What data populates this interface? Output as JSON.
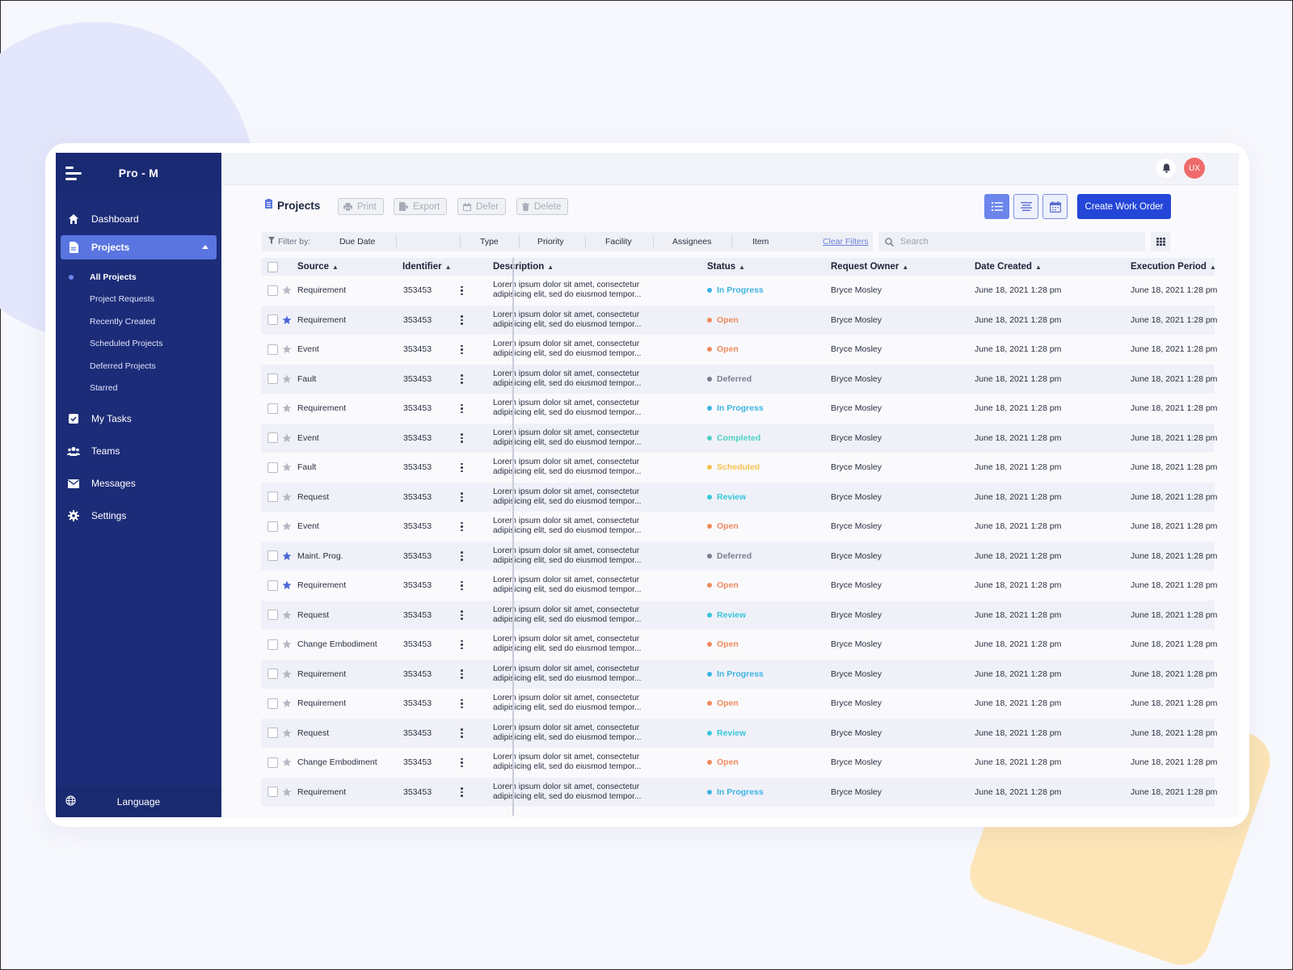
{
  "app": {
    "brand": "Pro - M"
  },
  "sidebar": {
    "items": [
      {
        "label": "Dashboard",
        "icon": "home-icon"
      },
      {
        "label": "Projects",
        "icon": "document-icon",
        "active": true
      },
      {
        "label": "My Tasks",
        "icon": "checkbox-icon"
      },
      {
        "label": "Teams",
        "icon": "team-icon"
      },
      {
        "label": "Messages",
        "icon": "mail-icon"
      },
      {
        "label": "Settings",
        "icon": "gear-icon"
      }
    ],
    "subitems": [
      {
        "label": "All Projects"
      },
      {
        "label": "Project Requests"
      },
      {
        "label": "Recently Created"
      },
      {
        "label": "Scheduled Projects"
      },
      {
        "label": "Deferred Projects"
      },
      {
        "label": "Starred"
      }
    ],
    "language": "Language"
  },
  "topbar": {
    "avatar": "UX"
  },
  "toolbar": {
    "title": "Projects",
    "print": "Print",
    "export": "Export",
    "defer": "Defer",
    "delete": "Delete",
    "create": "Create Work Order"
  },
  "filters": {
    "label": "Filter by:",
    "items": [
      "Due Date",
      "Type",
      "Priority",
      "Facility",
      "Assignees",
      "Item"
    ],
    "clear": "Clear Filters",
    "search_placeholder": "Search"
  },
  "table": {
    "columns": [
      "Source",
      "Identifier",
      "Description",
      "Status",
      "Request Owner",
      "Date Created",
      "Execution Period"
    ],
    "status_colors": {
      "In Progress": "#3fb3e3",
      "Open": "#f08a5d",
      "Deferred": "#7a7f8e",
      "Completed": "#4fd1c5",
      "Scheduled": "#f5c04f",
      "Review": "#38c6dc"
    },
    "rows": [
      {
        "source": "Requirement",
        "starred": false,
        "id": "353453",
        "desc1": "Lorem ipsum dolor sit amet, consectetur",
        "desc2": "adipisicing elit, sed do eiusmod tempor...",
        "status": "In Progress",
        "owner": "Bryce Mosley",
        "created": "June 18, 2021 1:28 pm",
        "exec": "June 18, 2021 1:28 pm"
      },
      {
        "source": "Requirement",
        "starred": true,
        "id": "353453",
        "desc1": "Lorem ipsum dolor sit amet, consectetur",
        "desc2": "adipisicing elit, sed do eiusmod tempor...",
        "status": "Open",
        "owner": "Bryce Mosley",
        "created": "June 18, 2021 1:28 pm",
        "exec": "June 18, 2021 1:28 pm"
      },
      {
        "source": "Event",
        "starred": false,
        "id": "353453",
        "desc1": "Lorem ipsum dolor sit amet, consectetur",
        "desc2": "adipisicing elit, sed do eiusmod tempor...",
        "status": "Open",
        "owner": "Bryce Mosley",
        "created": "June 18, 2021 1:28 pm",
        "exec": "June 18, 2021 1:28 pm"
      },
      {
        "source": "Fault",
        "starred": false,
        "id": "353453",
        "desc1": "Lorem ipsum dolor sit amet, consectetur",
        "desc2": "adipisicing elit, sed do eiusmod tempor...",
        "status": "Deferred",
        "owner": "Bryce Mosley",
        "created": "June 18, 2021 1:28 pm",
        "exec": "June 18, 2021 1:28 pm"
      },
      {
        "source": "Requirement",
        "starred": false,
        "id": "353453",
        "desc1": "Lorem ipsum dolor sit amet, consectetur",
        "desc2": "adipisicing elit, sed do eiusmod tempor...",
        "status": "In Progress",
        "owner": "Bryce Mosley",
        "created": "June 18, 2021 1:28 pm",
        "exec": "June 18, 2021 1:28 pm"
      },
      {
        "source": "Event",
        "starred": false,
        "id": "353453",
        "desc1": "Lorem ipsum dolor sit amet, consectetur",
        "desc2": "adipisicing elit, sed do eiusmod tempor...",
        "status": "Completed",
        "owner": "Bryce Mosley",
        "created": "June 18, 2021 1:28 pm",
        "exec": "June 18, 2021 1:28 pm"
      },
      {
        "source": "Fault",
        "starred": false,
        "id": "353453",
        "desc1": "Lorem ipsum dolor sit amet, consectetur",
        "desc2": "adipisicing elit, sed do eiusmod tempor...",
        "status": "Scheduled",
        "owner": "Bryce Mosley",
        "created": "June 18, 2021 1:28 pm",
        "exec": "June 18, 2021 1:28 pm"
      },
      {
        "source": "Request",
        "starred": false,
        "id": "353453",
        "desc1": "Lorem ipsum dolor sit amet, consectetur",
        "desc2": "adipisicing elit, sed do eiusmod tempor...",
        "status": "Review",
        "owner": "Bryce Mosley",
        "created": "June 18, 2021 1:28 pm",
        "exec": "June 18, 2021 1:28 pm"
      },
      {
        "source": "Event",
        "starred": false,
        "id": "353453",
        "desc1": "Lorem ipsum dolor sit amet, consectetur",
        "desc2": "adipisicing elit, sed do eiusmod tempor...",
        "status": "Open",
        "owner": "Bryce Mosley",
        "created": "June 18, 2021 1:28 pm",
        "exec": "June 18, 2021 1:28 pm"
      },
      {
        "source": "Maint. Prog.",
        "starred": true,
        "id": "353453",
        "desc1": "Lorem ipsum dolor sit amet, consectetur",
        "desc2": "adipisicing elit, sed do eiusmod tempor...",
        "status": "Deferred",
        "owner": "Bryce Mosley",
        "created": "June 18, 2021 1:28 pm",
        "exec": "June 18, 2021 1:28 pm"
      },
      {
        "source": "Requirement",
        "starred": true,
        "id": "353453",
        "desc1": "Lorem ipsum dolor sit amet, consectetur",
        "desc2": "adipisicing elit, sed do eiusmod tempor...",
        "status": "Open",
        "owner": "Bryce Mosley",
        "created": "June 18, 2021 1:28 pm",
        "exec": "June 18, 2021 1:28 pm"
      },
      {
        "source": "Request",
        "starred": false,
        "id": "353453",
        "desc1": "Lorem ipsum dolor sit amet, consectetur",
        "desc2": "adipisicing elit, sed do eiusmod tempor...",
        "status": "Review",
        "owner": "Bryce Mosley",
        "created": "June 18, 2021 1:28 pm",
        "exec": "June 18, 2021 1:28 pm"
      },
      {
        "source": "Change Embodiment",
        "starred": false,
        "id": "353453",
        "desc1": "Lorem ipsum dolor sit amet, consectetur",
        "desc2": "adipisicing elit, sed do eiusmod tempor...",
        "status": "Open",
        "owner": "Bryce Mosley",
        "created": "June 18, 2021 1:28 pm",
        "exec": "June 18, 2021 1:28 pm"
      },
      {
        "source": "Requirement",
        "starred": false,
        "id": "353453",
        "desc1": "Lorem ipsum dolor sit amet, consectetur",
        "desc2": "adipisicing elit, sed do eiusmod tempor...",
        "status": "In Progress",
        "owner": "Bryce Mosley",
        "created": "June 18, 2021 1:28 pm",
        "exec": "June 18, 2021 1:28 pm"
      },
      {
        "source": "Requirement",
        "starred": false,
        "id": "353453",
        "desc1": "Lorem ipsum dolor sit amet, consectetur",
        "desc2": "adipisicing elit, sed do eiusmod tempor...",
        "status": "Open",
        "owner": "Bryce Mosley",
        "created": "June 18, 2021 1:28 pm",
        "exec": "June 18, 2021 1:28 pm"
      },
      {
        "source": "Request",
        "starred": false,
        "id": "353453",
        "desc1": "Lorem ipsum dolor sit amet, consectetur",
        "desc2": "adipisicing elit, sed do eiusmod tempor...",
        "status": "Review",
        "owner": "Bryce Mosley",
        "created": "June 18, 2021 1:28 pm",
        "exec": "June 18, 2021 1:28 pm"
      },
      {
        "source": "Change Embodiment",
        "starred": false,
        "id": "353453",
        "desc1": "Lorem ipsum dolor sit amet, consectetur",
        "desc2": "adipisicing elit, sed do eiusmod tempor...",
        "status": "Open",
        "owner": "Bryce Mosley",
        "created": "June 18, 2021 1:28 pm",
        "exec": "June 18, 2021 1:28 pm"
      },
      {
        "source": "Requirement",
        "starred": false,
        "id": "353453",
        "desc1": "Lorem ipsum dolor sit amet, consectetur",
        "desc2": "adipisicing elit, sed do eiusmod tempor...",
        "status": "In Progress",
        "owner": "Bryce Mosley",
        "created": "June 18, 2021 1:28 pm",
        "exec": "June 18, 2021 1:28 pm"
      }
    ]
  }
}
